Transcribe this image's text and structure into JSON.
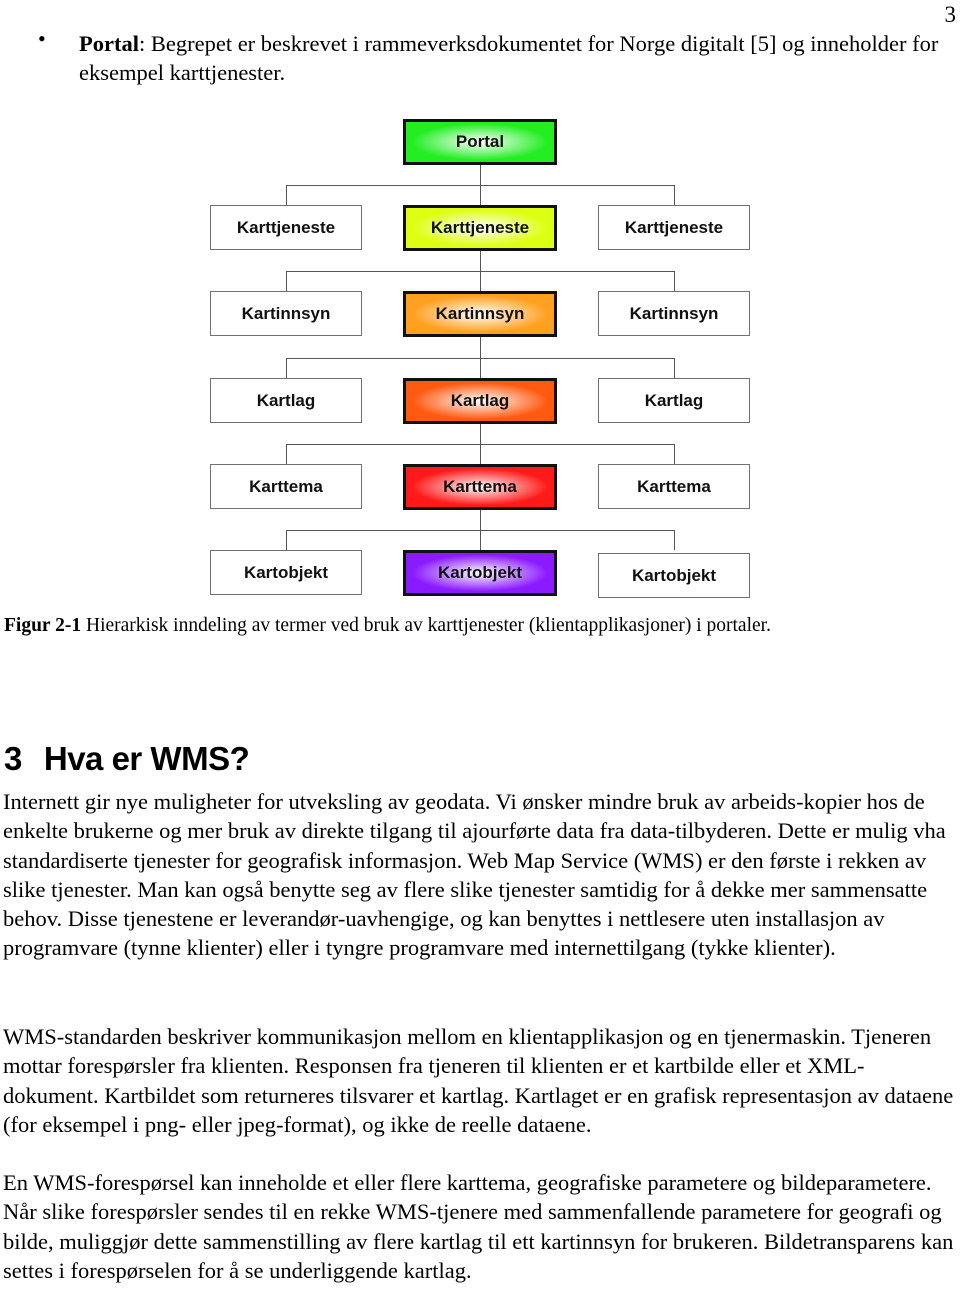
{
  "page_number": "3",
  "bullet": {
    "term": "Portal",
    "text": ": Begrepet er beskrevet i rammeverksdokumentet for Norge digitalt [5] og inneholder for eksempel karttjenester."
  },
  "diagram": {
    "center_column": [
      {
        "label": "Portal",
        "color": "#22ee22"
      },
      {
        "label": "Karttjeneste",
        "color": "#ddff11"
      },
      {
        "label": "Kartinnsyn",
        "color": "#ffa020"
      },
      {
        "label": "Kartlag",
        "color": "#ff5a10"
      },
      {
        "label": "Karttema",
        "color": "#ff1a1a"
      },
      {
        "label": "Kartobjekt",
        "color": "#8a1aff"
      }
    ],
    "side_rows": [
      {
        "left": "Karttjeneste",
        "right": "Karttjeneste"
      },
      {
        "left": "Kartinnsyn",
        "right": "Kartinnsyn"
      },
      {
        "left": "Kartlag",
        "right": "Kartlag"
      },
      {
        "left": "Karttema",
        "right": "Karttema"
      },
      {
        "left": "Kartobjekt",
        "right": "Kartobjekt"
      }
    ]
  },
  "caption": {
    "label": "Figur 2-1",
    "text": " Hierarkisk inndeling av termer ved bruk av karttjenester (klientapplikasjoner) i portaler."
  },
  "section": {
    "number": "3",
    "title": "Hva er WMS?"
  },
  "paragraphs": [
    "Internett gir nye muligheter for utveksling av geodata. Vi ønsker mindre bruk av arbeids-kopier hos de enkelte brukerne og mer bruk av direkte tilgang til ajourførte data fra data-tilbyderen. Dette er mulig vha standardiserte tjenester for geografisk informasjon. Web Map Service (WMS) er den første i rekken av slike tjenester. Man kan også benytte seg av flere slike tjenester samtidig for å dekke mer sammensatte behov. Disse tjenestene er leverandør-uavhengige, og kan benyttes i nettlesere uten installasjon av programvare (tynne klienter) eller i tyngre programvare med internettilgang (tykke klienter).",
    "WMS-standarden beskriver kommunikasjon mellom en klientapplikasjon og en tjenermaskin. Tjeneren mottar forespørsler fra klienten. Responsen fra tjeneren til klienten er et kartbilde eller et XML-dokument. Kartbildet som returneres tilsvarer et kartlag. Kartlaget er en grafisk representasjon av dataene (for eksempel i png- eller jpeg-format), og ikke de reelle dataene.",
    "En WMS-forespørsel kan inneholde et eller flere karttema, geografiske parametere og bildeparametere. Når slike forespørsler sendes til en rekke WMS-tjenere med sammenfallende parametere for geografi og bilde, muliggjør dette sammenstilling av flere kartlag til ett kartinnsyn for brukeren. Bildetransparens kan settes i forespørselen for å se underliggende kartlag."
  ]
}
